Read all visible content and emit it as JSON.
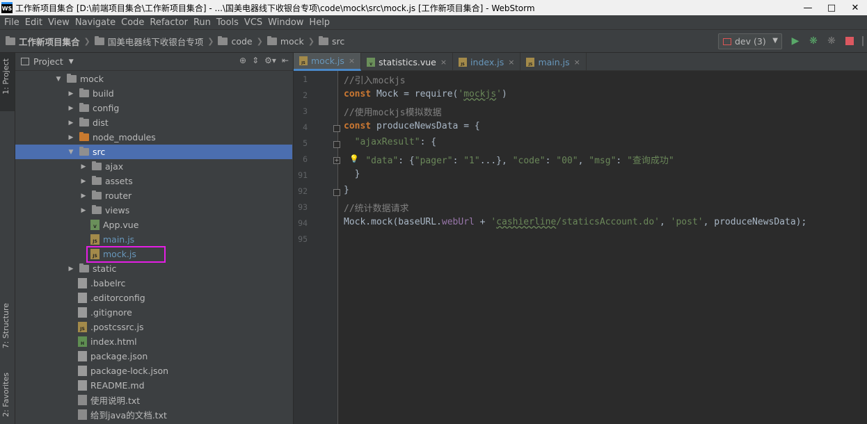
{
  "window": {
    "title": "工作新项目集合 [D:\\前端项目集合\\工作新项目集合] - ...\\国美电器线下收银台专项\\code\\mock\\src\\mock.js [工作新项目集合] - WebStorm",
    "app_icon_label": "WS"
  },
  "menu": [
    "File",
    "Edit",
    "View",
    "Navigate",
    "Code",
    "Refactor",
    "Run",
    "Tools",
    "VCS",
    "Window",
    "Help"
  ],
  "breadcrumb": [
    "工作新项目集合",
    "国美电器线下收银台专项",
    "code",
    "mock",
    "src"
  ],
  "run_config": {
    "label": "dev (3)"
  },
  "left_tool_tabs": {
    "project": "1: Project",
    "structure": "7: Structure",
    "favorites": "2: Favorites"
  },
  "project_panel": {
    "title": "Project",
    "tree": [
      {
        "label": "mock",
        "type": "folder",
        "expanded": true,
        "depth": 0
      },
      {
        "label": "build",
        "type": "folder",
        "expanded": false,
        "depth": 1
      },
      {
        "label": "config",
        "type": "folder",
        "expanded": false,
        "depth": 1
      },
      {
        "label": "dist",
        "type": "folder",
        "expanded": false,
        "depth": 1
      },
      {
        "label": "node_modules",
        "type": "folder-excluded",
        "expanded": false,
        "depth": 1
      },
      {
        "label": "src",
        "type": "folder",
        "expanded": true,
        "depth": 1,
        "selected": true
      },
      {
        "label": "ajax",
        "type": "folder",
        "expanded": false,
        "depth": 2
      },
      {
        "label": "assets",
        "type": "folder",
        "expanded": false,
        "depth": 2
      },
      {
        "label": "router",
        "type": "folder",
        "expanded": false,
        "depth": 2
      },
      {
        "label": "views",
        "type": "folder",
        "expanded": false,
        "depth": 2
      },
      {
        "label": "App.vue",
        "type": "vue",
        "depth": 2
      },
      {
        "label": "main.js",
        "type": "js",
        "depth": 2,
        "modified": true
      },
      {
        "label": "mock.js",
        "type": "js",
        "depth": 2,
        "modified": true,
        "highlighted": true
      },
      {
        "label": "static",
        "type": "folder",
        "expanded": false,
        "depth": 1
      },
      {
        "label": ".babelrc",
        "type": "file",
        "depth": 1
      },
      {
        "label": ".editorconfig",
        "type": "file",
        "depth": 1
      },
      {
        "label": ".gitignore",
        "type": "file",
        "depth": 1
      },
      {
        "label": ".postcssrc.js",
        "type": "js",
        "depth": 1
      },
      {
        "label": "index.html",
        "type": "html",
        "depth": 1
      },
      {
        "label": "package.json",
        "type": "file",
        "depth": 1
      },
      {
        "label": "package-lock.json",
        "type": "file",
        "depth": 1
      },
      {
        "label": "README.md",
        "type": "file",
        "depth": 1
      },
      {
        "label": "使用说明.txt",
        "type": "txt",
        "depth": 1
      },
      {
        "label": "给到java的文档.txt",
        "type": "txt",
        "depth": 1
      }
    ]
  },
  "editor_tabs": [
    {
      "label": "mock.js",
      "type": "js",
      "active": true
    },
    {
      "label": "statistics.vue",
      "type": "vue",
      "active": false
    },
    {
      "label": "index.js",
      "type": "js",
      "active": false
    },
    {
      "label": "main.js",
      "type": "js",
      "active": false
    }
  ],
  "code_lines": [
    {
      "num": "1",
      "text": "//引入mockjs"
    },
    {
      "num": "2",
      "text": "const Mock = require('mockjs')"
    },
    {
      "num": "3",
      "text": "//使用mockjs模拟数据"
    },
    {
      "num": "4",
      "text": "const produceNewsData = {"
    },
    {
      "num": "5",
      "text": "  \"ajaxResult\": {"
    },
    {
      "num": "6",
      "text": "    \"data\": {\"pager\": \"1\"...}, \"code\": \"00\", \"msg\": \"查询成功\""
    },
    {
      "num": "91",
      "text": "  }"
    },
    {
      "num": "92",
      "text": "}"
    },
    {
      "num": "93",
      "text": "//统计数据请求"
    },
    {
      "num": "94",
      "text": "Mock.mock(baseURL.webUrl + 'cashierline/staticsAccount.do', 'post', produceNewsData);"
    },
    {
      "num": "95",
      "text": ""
    }
  ],
  "colors": {
    "accent_selection": "#4b6eaf",
    "highlight_box": "#e51ee5",
    "editor_bg": "#2b2b2b",
    "panel_bg": "#3c3f41"
  },
  "icons": {
    "run": "run-icon",
    "debug": "debug-icon",
    "coverage": "coverage-icon",
    "stop": "stop-icon",
    "settings": "gear-icon"
  }
}
